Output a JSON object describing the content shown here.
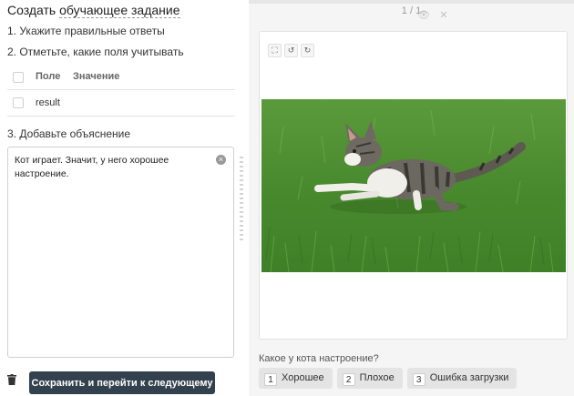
{
  "task": {
    "title_prefix": "Создать ",
    "title_dashed": "обучающее задание",
    "step1": "1. Укажите правильные ответы",
    "step2": "2. Отметьте, какие поля учитывать",
    "step3": "3. Добавьте объяснение"
  },
  "fields_table": {
    "headers": {
      "field": "Поле",
      "value": "Значение"
    },
    "rows": [
      {
        "field": "result"
      }
    ]
  },
  "explanation": {
    "value": "Кот играет. Значит, у него хорошее настроение."
  },
  "actions": {
    "delete_icon": "trash-icon",
    "save_label": "Сохранить и перейти к следующему"
  },
  "preview": {
    "pager": "1 / 1",
    "icons": [
      "eye-icon",
      "close-icon"
    ],
    "tools": [
      "fullscreen-icon",
      "rotate-left-icon",
      "rotate-right-icon"
    ],
    "image_subject": "kitten on grass",
    "question": "Какое у кота настроение?",
    "answers": [
      {
        "key": "1",
        "label": "Хорошее"
      },
      {
        "key": "2",
        "label": "Плохое"
      },
      {
        "key": "3",
        "label": "Ошибка загрузки"
      }
    ]
  },
  "colors": {
    "primary_button": "#33414f",
    "panel_bg": "#f5f5f5",
    "answer_bg": "#e4e4e4"
  }
}
